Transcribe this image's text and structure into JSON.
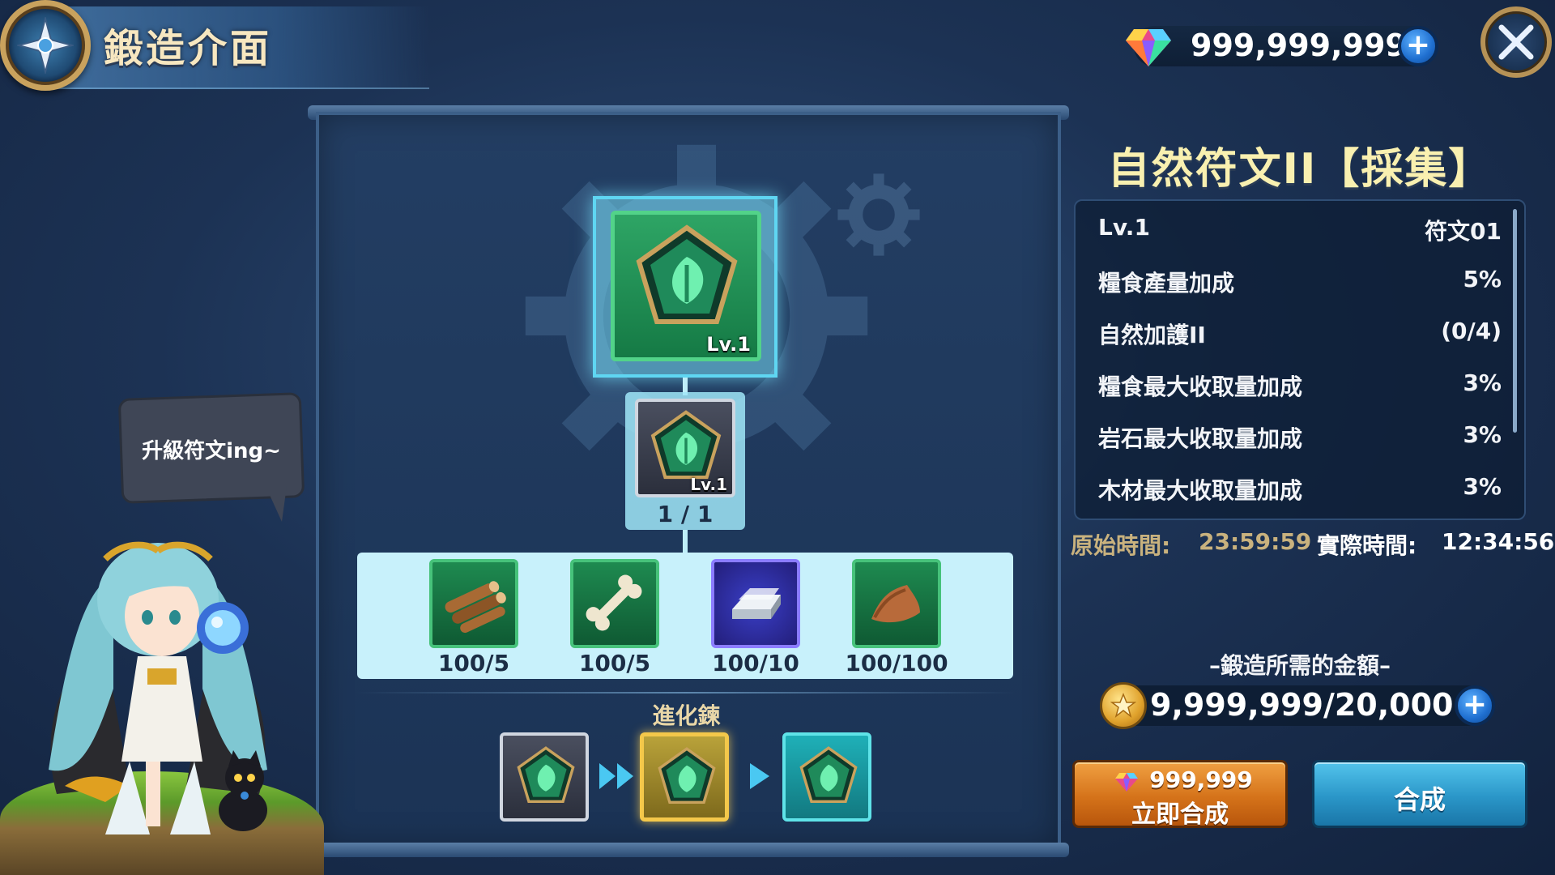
{
  "header": {
    "title": "鍛造介面",
    "gem_amount": "999,999,999",
    "gem_plus": "+"
  },
  "center": {
    "main_rune_level": "Lv.1",
    "required_rune_level": "Lv.1",
    "required_rune_count": "1 / 1",
    "materials": [
      {
        "name": "wood-logs-icon",
        "count": "100/5"
      },
      {
        "name": "bone-icon",
        "count": "100/5"
      },
      {
        "name": "silver-ingot-icon",
        "count": "100/10"
      },
      {
        "name": "leather-hide-icon",
        "count": "100/100"
      }
    ],
    "evolution_label": "進化鍊"
  },
  "character": {
    "speech": "升級符文ing~"
  },
  "info": {
    "rune_name": "自然符文II【採集】",
    "stats": [
      {
        "label": "Lv.1",
        "value": "符文01"
      },
      {
        "label": "糧食產量加成",
        "value": "5%"
      },
      {
        "label": "自然加護II",
        "value": "(0/4)"
      },
      {
        "label": "糧食最大收取量加成",
        "value": "3%"
      },
      {
        "label": "岩石最大收取量加成",
        "value": "3%"
      },
      {
        "label": "木材最大收取量加成",
        "value": "3%"
      }
    ],
    "original_time_label": "原始時間:",
    "original_time": "23:59:59",
    "actual_time_label": "實際時間:",
    "actual_time": "12:34:56",
    "cost_label": "–鍛造所需的金額–",
    "gold_amount": "9,999,999/20,000",
    "gold_plus": "+"
  },
  "buttons": {
    "instant_cost": "999,999",
    "instant_label": "立即合成",
    "forge_label": "合成"
  },
  "colors": {
    "accent_gold": "#f9f0b0",
    "forge_button": "#2a96c8",
    "instant_button": "#d5731a",
    "rune_green": "#2ea565"
  }
}
